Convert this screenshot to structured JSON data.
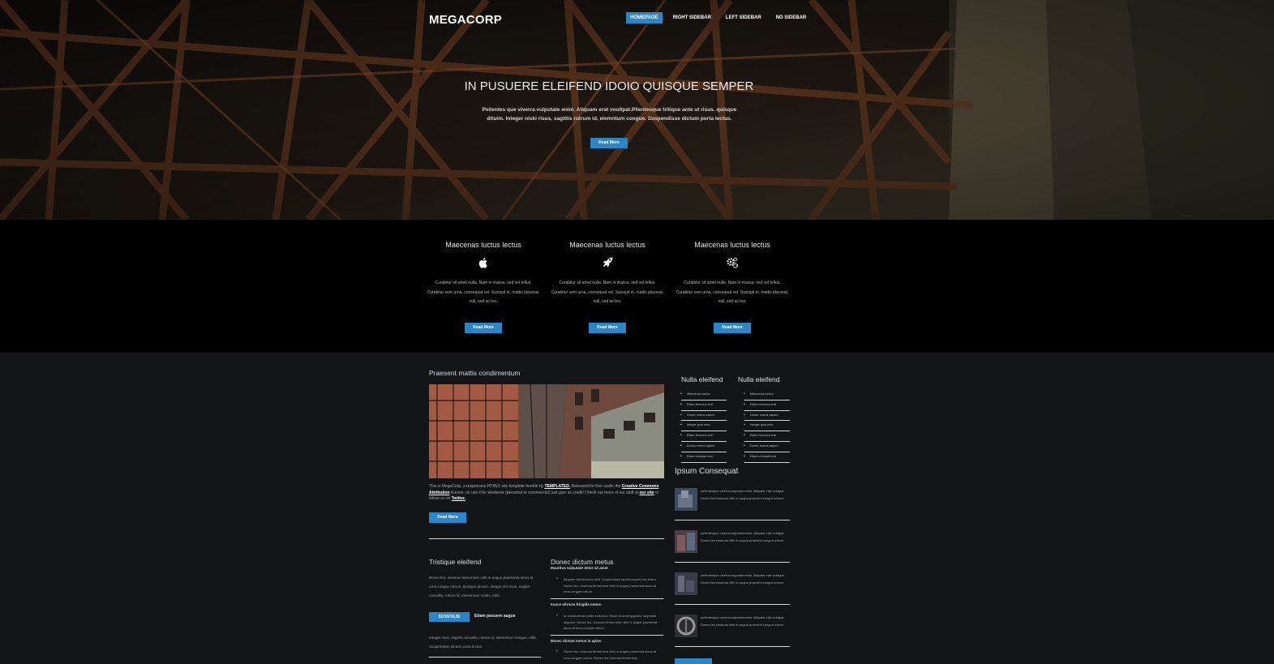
{
  "header": {
    "logo": "MEGACORP",
    "nav": [
      "HOMEPAGE",
      "RIGHT SIDEBAR",
      "LEFT SIDEBAR",
      "NO SIDEBAR"
    ]
  },
  "hero": {
    "title": "IN PUSUERE ELEIFEND IDOIO QUISQUE SEMPER",
    "subtitle": "Pellentes que viverra vulputate enim. Aliquam erat voultpat.Pllentesque tritique ante ut risus. quisque dituim. Integer niski risus, sagittis rutrum id, elemntum congue. Suspendisse dictum porta lectus.",
    "button": "Read More"
  },
  "features": [
    {
      "title": "Maecenas luctus lectus",
      "icon": "apple-icon",
      "text": "Curabitur sit amet nulla. Nam in massa. sed vel tellus. Curabitur sem urna, consequat vel. Suscipit in, mattis placerat, null, sed ac leo.",
      "button": "Read More"
    },
    {
      "title": "Maecenas luctus lectus",
      "icon": "rocket-icon",
      "text": "Curabitur sit amet nulla. Nam in massa. sed vel tellus. Curabitur sem urna, consequat vel. Suscipit in, mattis placerat, null, sed ac leo.",
      "button": "Read More"
    },
    {
      "title": "Maecenas luctus lectus",
      "icon": "gears-icon",
      "text": "Curabitur sit amet nulla. Nam in massa. sed vel tellus. Curabitur sem urna, consequat vel. Suscipit in, mattis placerat, null, sed ac leo.",
      "button": "Read More"
    }
  ],
  "main": {
    "heading": "Praesent mattis condimentum",
    "intro": {
      "t1": "This is MegaCorp, a responsive HTML5 site template freebie by ",
      "l1": "TEMPLATED.",
      "t2": " Released for free under the ",
      "l2": "Creative Commons Attribution",
      "t3": " license, so use it for whatever (personal or commercial) just give us credit! Check out more of our stuff at ",
      "l3": "our site",
      "t4": " or follow us on ",
      "l4": "Twitter."
    },
    "button": "Read More",
    "tristique": {
      "title": "Tristique eleifend",
      "para1": "Donec leo, vivamus fermentum nibh in augue praesenta lacus at urna congue rutrum. Quisque dictum. Integer nisl risus, sagittis convallis, rutrum id, elementum mattis, nibh.",
      "date": "02/10/10,55",
      "date_label": "Etiam posuere augue",
      "para2": "Integer risus, sagittis convallis, rutrum id, elementum congue, nibh. Suspendisse dictum porta lectus."
    },
    "donec": {
      "title": "Donec dictum metus",
      "s1_title": "Mauritus vulputate dolor sit amet",
      "s1_item": "Aliquam lacinia risus dolli. Suspendisse iaculis mauris nec lorem. Donec leo, vivamus fermentum nibh in augue praesenta lacus at urna congue rutrum.",
      "s2_title": "Fusce ultrices fringilla metus",
      "s2_item": "In consectetuer pede euismod. Vivam id amet grgurilur vulputate aliquam. Donec leo, vivamus fermentum nibh in augue praesenta lacus at urna congue rutrum.",
      "s3_title": "Donec dictum metus in apien",
      "s3_item": "Donec leo, vivamus fermentum nibh in augue praesenta lacus at urna congue rutrum. Donec leo vivamus fermentum."
    }
  },
  "sidebar": {
    "list_a": {
      "title": "Nulla eleifend",
      "items": [
        "Maecenas luctus",
        "Etiam rhoncus erat",
        "Donec metus sapien",
        "Integer quis uma",
        "Etiam rhoncus erat",
        "Donec metus sapien",
        "Etiam volutpat erat"
      ]
    },
    "list_b": {
      "title": "Nulla eleifend",
      "items": [
        "Maecenas luctus",
        "Etiam rhoncus erat",
        "Donec metus sapien",
        "Integer quis uma",
        "Etiam rhoncus erat",
        "Donec metus sapien",
        "Etiam volutpat erat"
      ]
    },
    "ipsum": {
      "title": "Ipsum Consequat",
      "items": [
        "pellentesque viverra vulputate enim. Aliquam erat volutpat. Donec leo vivamus nibh in augue praesent congue rutrum",
        "pellentesque viverra vulputate enim. Aliquam erat volutpat. Donec leo vivamus nibh in augue praesent congue rutrum",
        "pellentesque viverra vulputate enim. Aliquam erat volutpat. Donec leo vivamus nibh in augue praesent congue rutrum",
        "pellentesque viverra vulputate enim. Aliquam erat volutpat. Donec leo vivamus nibh in augue praesent congue rutrum"
      ]
    }
  },
  "colors": {
    "accent": "#2b86c8",
    "feature_bg": "#000000",
    "body_bg": "#131416"
  }
}
